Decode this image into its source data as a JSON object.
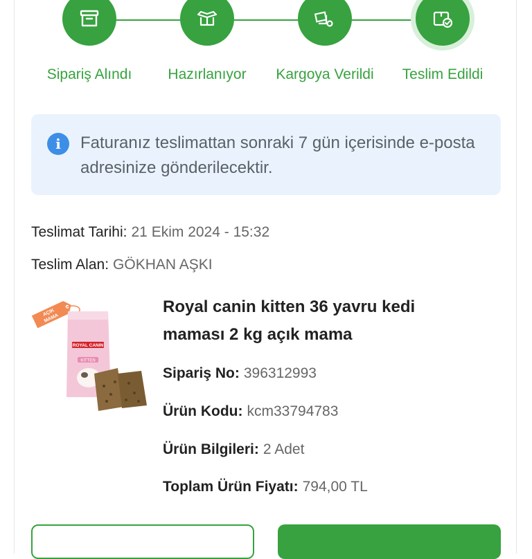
{
  "stepper": {
    "steps": [
      {
        "label": "Sipariş Alındı",
        "icon": "box-icon"
      },
      {
        "label": "Hazırlanıyor",
        "icon": "package-open-icon"
      },
      {
        "label": "Kargoya Verildi",
        "icon": "truck-icon"
      },
      {
        "label": "Teslim Edildi",
        "icon": "delivered-check-icon"
      }
    ],
    "active_index": 3,
    "color": "#37a23f"
  },
  "info": {
    "icon": "info-icon",
    "text": "Faturanız teslimattan sonraki 7 gün içerisinde e-posta adresinize gönderilecektir."
  },
  "delivery": {
    "date_label": "Teslimat Tarihi:",
    "date_value": "21 Ekim 2024 - 15:32",
    "receiver_label": "Teslim Alan:",
    "receiver_value": "GÖKHAN AŞKI"
  },
  "product": {
    "badge": "AÇIK MAMA",
    "brand": "ROYAL CANIN",
    "variant": "KITTEN",
    "title": "Royal canin kitten 36 yavru kedi maması 2 kg açık mama",
    "order_no_label": "Sipariş No:",
    "order_no": "396312993",
    "code_label": "Ürün Kodu:",
    "code": "kcm33794783",
    "info_label": "Ürün Bilgileri:",
    "info": "2 Adet",
    "price_label": "Toplam Ürün Fiyatı:",
    "price": "794,00 TL"
  }
}
